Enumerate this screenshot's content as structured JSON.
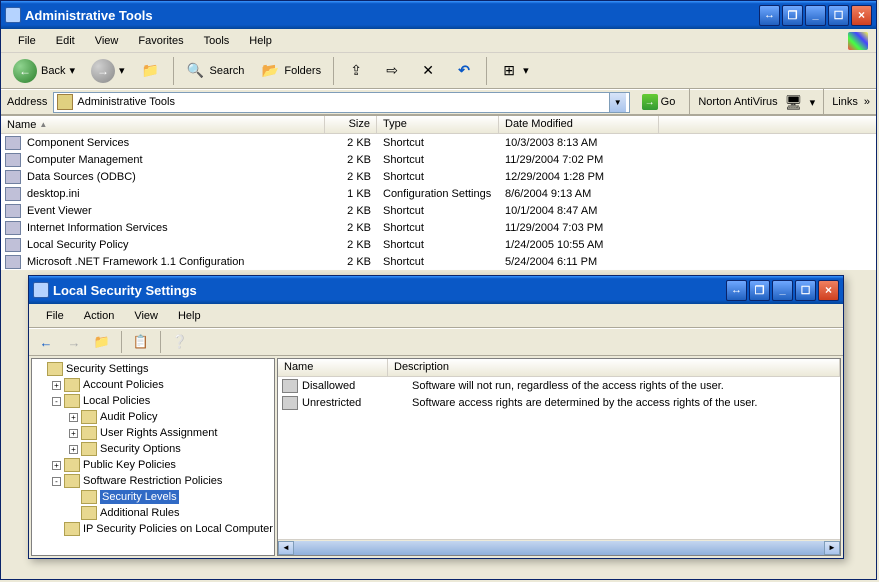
{
  "main_window": {
    "title": "Administrative Tools",
    "menus": [
      "File",
      "Edit",
      "View",
      "Favorites",
      "Tools",
      "Help"
    ],
    "toolbar": {
      "back": "Back",
      "search": "Search",
      "folders": "Folders"
    },
    "address": {
      "label": "Address",
      "value": "Administrative Tools",
      "go": "Go",
      "norton": "Norton AntiVirus",
      "links": "Links"
    },
    "columns": {
      "name": "Name",
      "size": "Size",
      "type": "Type",
      "date": "Date Modified"
    },
    "rows": [
      {
        "name": "Component Services",
        "size": "2 KB",
        "type": "Shortcut",
        "date": "10/3/2003 8:13 AM"
      },
      {
        "name": "Computer Management",
        "size": "2 KB",
        "type": "Shortcut",
        "date": "11/29/2004 7:02 PM"
      },
      {
        "name": "Data Sources (ODBC)",
        "size": "2 KB",
        "type": "Shortcut",
        "date": "12/29/2004 1:28 PM"
      },
      {
        "name": "desktop.ini",
        "size": "1 KB",
        "type": "Configuration Settings",
        "date": "8/6/2004 9:13 AM"
      },
      {
        "name": "Event Viewer",
        "size": "2 KB",
        "type": "Shortcut",
        "date": "10/1/2004 8:47 AM"
      },
      {
        "name": "Internet Information Services",
        "size": "2 KB",
        "type": "Shortcut",
        "date": "11/29/2004 7:03 PM"
      },
      {
        "name": "Local Security Policy",
        "size": "2 KB",
        "type": "Shortcut",
        "date": "1/24/2005 10:55 AM"
      },
      {
        "name": "Microsoft .NET Framework 1.1 Configuration",
        "size": "2 KB",
        "type": "Shortcut",
        "date": "5/24/2004 6:11 PM"
      }
    ]
  },
  "child_window": {
    "title": "Local Security Settings",
    "menus": [
      "File",
      "Action",
      "View",
      "Help"
    ],
    "tree": {
      "root": "Security Settings",
      "account": "Account Policies",
      "local": "Local Policies",
      "audit": "Audit Policy",
      "urights": "User Rights Assignment",
      "secopt": "Security Options",
      "pubkey": "Public Key Policies",
      "srp": "Software Restriction Policies",
      "seclevels": "Security Levels",
      "addrules": "Additional Rules",
      "ipsec": "IP Security Policies on Local Computer"
    },
    "detail_cols": {
      "name": "Name",
      "desc": "Description"
    },
    "detail_rows": [
      {
        "name": "Disallowed",
        "desc": "Software will not run, regardless of the access rights of the user."
      },
      {
        "name": "Unrestricted",
        "desc": "Software access rights are determined by the access rights of the user."
      }
    ]
  }
}
